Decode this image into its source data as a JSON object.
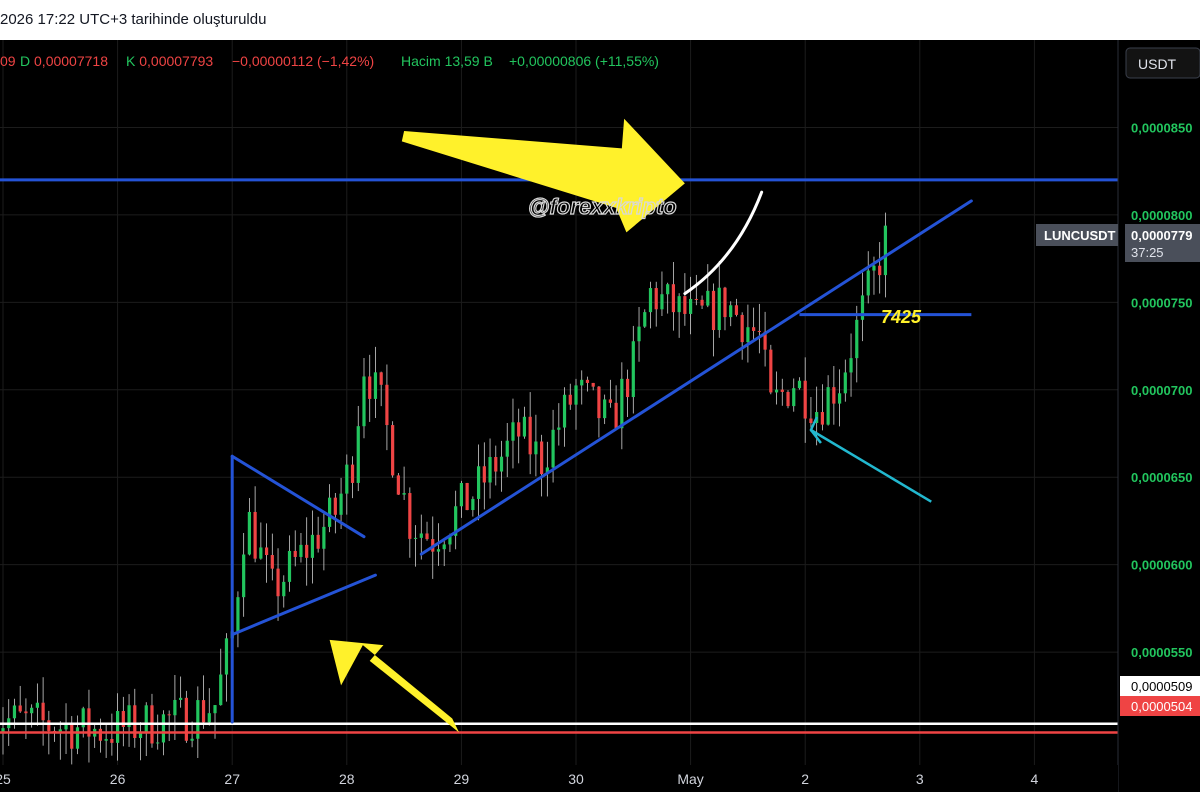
{
  "header": {
    "created": "2026 17:22 UTC+3 tarihinde oluşturuldu"
  },
  "legend": {
    "first": "09",
    "low_label": "D",
    "low_value": "0,00007718",
    "close_label": "K",
    "close_value": "0,00007793",
    "change": "−0,00000112 (−1,42%)",
    "volume_label": "Hacim",
    "volume_value": "13,59 B",
    "volume_change": "+0,00000806 (+11,55%)"
  },
  "watermark": "@forexxkripto",
  "currency": "USDT",
  "colors": {
    "up": "#22c55e",
    "down": "#ef4444",
    "axis_text": "#22c55e",
    "trend_line": "#2453d6",
    "arrow_yellow": "#fff12b",
    "arrow_cyan": "#22b8cf",
    "level_red": "#ef4444",
    "level_white": "#ffffff"
  },
  "chart_data": {
    "type": "candlestick",
    "symbol": "LUNCUSDT",
    "countdown": "37:25",
    "x_ticks": [
      "25",
      "26",
      "27",
      "28",
      "29",
      "30",
      "May",
      "2",
      "3",
      "4"
    ],
    "y_ticks": [
      "0,0000850",
      "0,0000800",
      "0,0000750",
      "0,0000700",
      "0,0000650",
      "0,0000600",
      "0,0000550"
    ],
    "ylim": [
      4.7e-05,
      9e-05
    ],
    "price_labels": {
      "last": "0,0000779",
      "white_level": "0,0000509",
      "red_level": "0,0000504"
    },
    "levels": {
      "resistance": 8.2e-05,
      "white": 5.09e-05,
      "red": 5.04e-05,
      "support_short": 7.43e-05
    },
    "annotation": "7425",
    "path_days": [
      24.9,
      25.9,
      26.6,
      26.85,
      27.0,
      27.12,
      27.35,
      27.6,
      27.9,
      28.05,
      28.15,
      28.3,
      28.55,
      28.75,
      29.1,
      29.5,
      29.7,
      30.0,
      30.3,
      30.5,
      30.65,
      30.9,
      31.05,
      31.3,
      31.6,
      31.7,
      31.9,
      32.1,
      32.3,
      32.5,
      32.7
    ],
    "path_prices": [
      5.12e-05,
      5.05e-05,
      5.13e-05,
      5.2e-05,
      5.6e-05,
      6.3e-05,
      5.85e-05,
      6.05e-05,
      6.3e-05,
      6.6e-05,
      7.15e-05,
      6.9e-05,
      6.25e-05,
      6.15e-05,
      6.4e-05,
      6.75e-05,
      6.6e-05,
      7e-05,
      6.8e-05,
      7.15e-05,
      7.55e-05,
      7.45e-05,
      7.4e-05,
      7.5e-05,
      7.3e-05,
      6.9e-05,
      7.05e-05,
      6.9e-05,
      7.05e-05,
      7.45e-05,
      7.85e-05
    ]
  }
}
